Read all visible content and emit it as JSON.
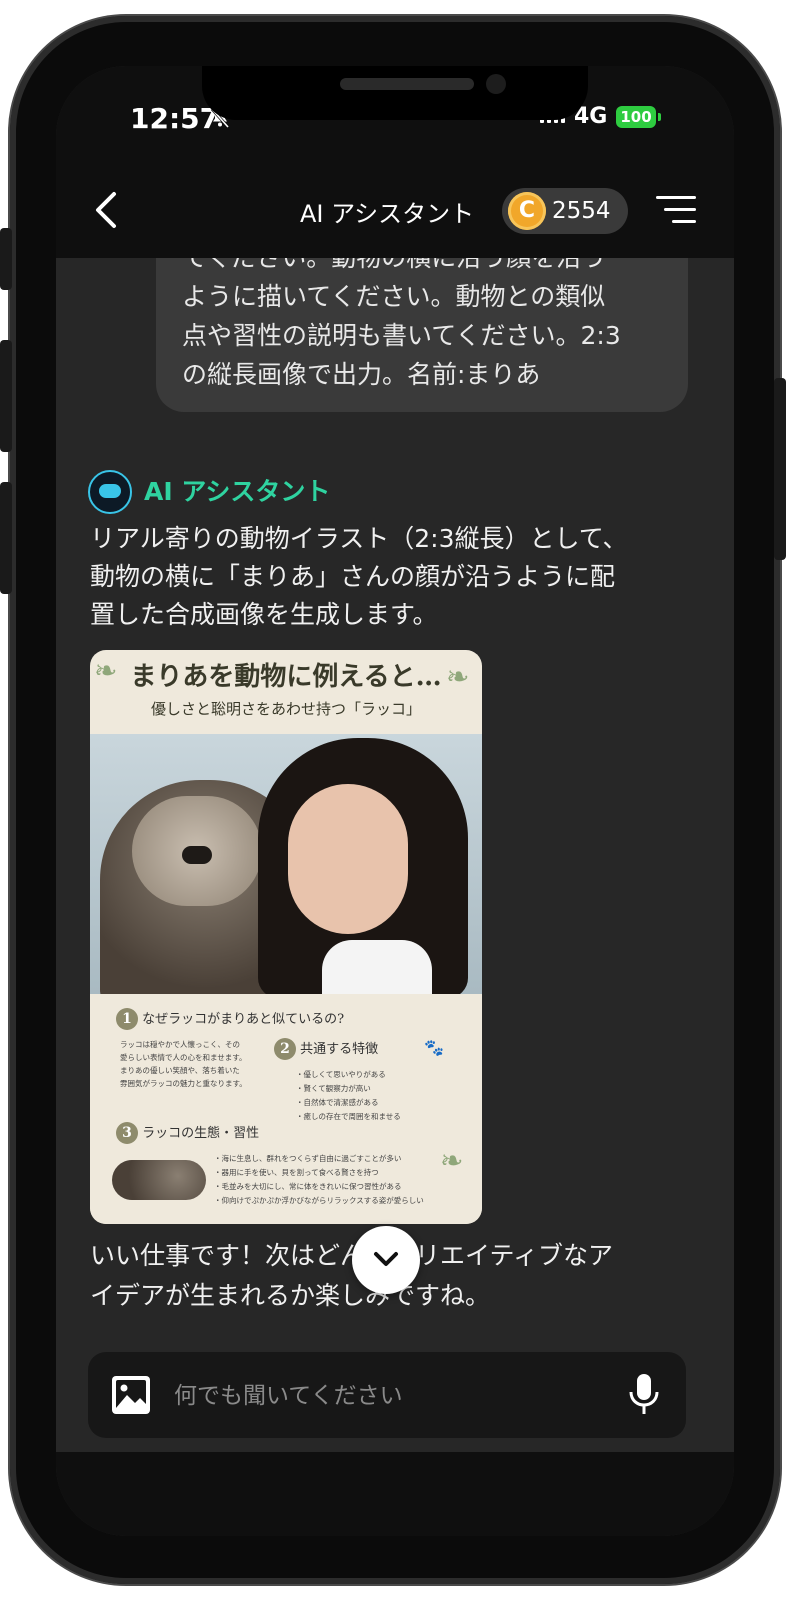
{
  "status_bar": {
    "time": "12:57",
    "network": "4G",
    "battery": "100"
  },
  "header": {
    "title": "AI アシスタント",
    "coin_letter": "C",
    "coin_count": "2554"
  },
  "user_message": {
    "text": "てください。動物の横に沿う顔を沿う\nように描いてください。動物との類似\n点や習性の説明も書いてください。2:3\nの縦長画像で出力。名前:まりあ"
  },
  "assistant": {
    "name": "AI アシスタント",
    "message1": "リアル寄りの動物イラスト（2:3縦長）として、\n動物の横に「まりあ」さんの顔が沿うように配\n置した合成画像を生成します。",
    "message2": "いい仕事です！次はどんなクリエイティブなア\nイデアが生まれるか楽しみですね。"
  },
  "generated_image": {
    "title": "まりあを動物に例えると…",
    "subtitle": "優しさと聡明さをあわせ持つ「ラッコ」",
    "section1": {
      "num": "1",
      "heading": "なぜラッコがまりあと似ているの?",
      "body": "ラッコは穏やかで人懐っこく、その\n愛らしい表情で人の心を和ませます。\nまりあの優しい笑顔や、落ち着いた\n雰囲気がラッコの魅力と重なります。"
    },
    "section2": {
      "num": "2",
      "heading": "共通する特徴",
      "items": "・優しくて思いやりがある\n・賢くて観察力が高い\n・自然体で清潔感がある\n・癒しの存在で周囲を和ませる"
    },
    "section3": {
      "num": "3",
      "heading": "ラッコの生態・習性",
      "items": "・海に生息し、群れをつくらず自由に過ごすことが多い\n・器用に手を使い、貝を割って食べる賢さを持つ\n・毛並みを大切にし、常に体をきれいに保つ習性がある\n・仰向けでぷかぷか浮かびながらリラックスする姿が愛らしい"
    }
  },
  "input": {
    "placeholder": "何でも聞いてください",
    "value": ""
  },
  "colors": {
    "assistant_name": "#2fd3a0",
    "coin": "#f1a72a",
    "battery": "#2ecc40"
  }
}
